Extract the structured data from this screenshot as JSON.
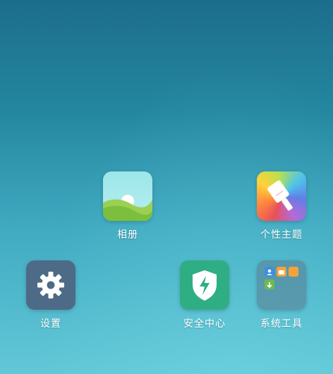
{
  "home_screen": {
    "apps": {
      "gallery": {
        "label": "相册",
        "icon": "gallery-icon"
      },
      "themes": {
        "label": "个性主题",
        "icon": "paintbrush-icon"
      },
      "settings": {
        "label": "设置",
        "icon": "gear-icon"
      },
      "security": {
        "label": "安全中心",
        "icon": "shield-lightning-icon"
      },
      "tools_folder": {
        "label": "系统工具",
        "icon": "folder-icon",
        "mini_icons": [
          "contacts-icon",
          "message-icon",
          "notes-icon",
          "download-icon"
        ]
      }
    }
  },
  "colors": {
    "wallpaper_top": "#1c6d8c",
    "wallpaper_bottom": "#62c8d8",
    "settings_bg": "#4d6b86",
    "security_bg": "#2fae84",
    "folder_mini_blue": "#3b8fe0",
    "folder_mini_orange": "#f5a23c",
    "folder_mini_green": "#6dbb4f"
  }
}
